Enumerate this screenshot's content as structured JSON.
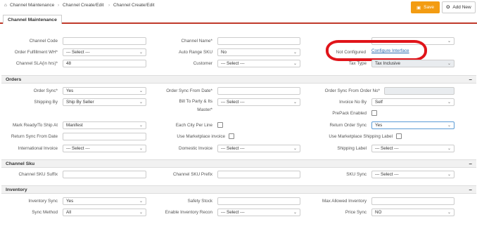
{
  "breadcrumb": [
    "Channel Maintenance",
    "Channel Create/Edit",
    "Channel Create/Edit"
  ],
  "toolbar": {
    "save_label": "Save",
    "addnew_label": "Add New"
  },
  "tab": "Channel Maintenance",
  "general": {
    "channel_code_label": "Channel Code",
    "channel_name_label": "Channel Name*",
    "order_fulfillment_label": "Order Fulfillment WH*",
    "order_fulfillment_value": "--- Select ---",
    "auto_range_label": "Auto Range SKU",
    "auto_range_value": "No",
    "not_configured": "Not Configured",
    "configure_interface": "Configure Interface",
    "channel_sla_label": "Channel SLA(in hrs)*",
    "channel_sla_value": "48",
    "customer_label": "Customer",
    "customer_value": "--- Select ---",
    "tax_type_label": "Tax Type",
    "tax_type_value": "Tax Inclusive"
  },
  "orders": {
    "title": "Orders",
    "order_sync_label": "Order Sync*",
    "order_sync_value": "Yes",
    "order_sync_from_date_label": "Order Sync From Date*",
    "order_sync_from_no_label": "Order Sync From Order No*",
    "shipping_by_label": "Shipping By",
    "shipping_by_value": "Ship By Seller",
    "bill_to_party_label": "Bill To Party & Its",
    "bill_to_party_label2": "Master*",
    "bill_to_party_value": "--- Select ---",
    "invoice_no_by_label": "Invoice No By",
    "invoice_no_by_value": "Self",
    "prepack_enabled_label": "PrePack Enabled",
    "mark_ready_label": "Mark Ready/To Ship At",
    "mark_ready_value": "Manifest",
    "each_city_label": "Each City Per Line",
    "return_order_sync_label": "Return Order Sync",
    "return_order_sync_value": "Yes",
    "return_sync_from_date_label": "Return Sync From Date",
    "use_marketplace_invoice_label": "Use Marketplace invoice",
    "use_marketplace_shipping_label": "Use Marketplace Shipping Label",
    "international_invoice_label": "International Invoice",
    "international_invoice_value": "--- Select ---",
    "domestic_invoice_label": "Domestic Invoice",
    "domestic_invoice_value": "--- Select ---",
    "shipping_label_label": "Shipping Label",
    "shipping_label_value": "--- Select ---"
  },
  "channel_sku": {
    "title": "Channel Sku",
    "suffix_label": "Channel SKU Suffix",
    "prefix_label": "Channel SKU Prefix",
    "sku_sync_label": "SKU Sync",
    "sku_sync_value": "--- Select ---"
  },
  "inventory": {
    "title": "Inventory",
    "inventory_sync_label": "Inventory Sync",
    "inventory_sync_value": "Yes",
    "safety_stock_label": "Safety Stock",
    "max_allowed_label": "Max Allowed Inventory",
    "sync_method_label": "Sync Method",
    "sync_method_value": "All",
    "enable_inventory_recon_label": "Enable Inventory Recon",
    "enable_inventory_recon_value": "--- Select ---",
    "price_sync_label": "Price Sync",
    "price_sync_value": "NO"
  },
  "icons": {
    "home": "home-icon",
    "save": "floppy-icon",
    "add": "plus-icon",
    "collapse": "minus-icon",
    "chevron": "chevron-down-icon"
  },
  "colors": {
    "accent": "#f39c12",
    "tab_underline": "#c0392b",
    "highlight_circle": "#e0141a",
    "link": "#2b6cb0"
  }
}
